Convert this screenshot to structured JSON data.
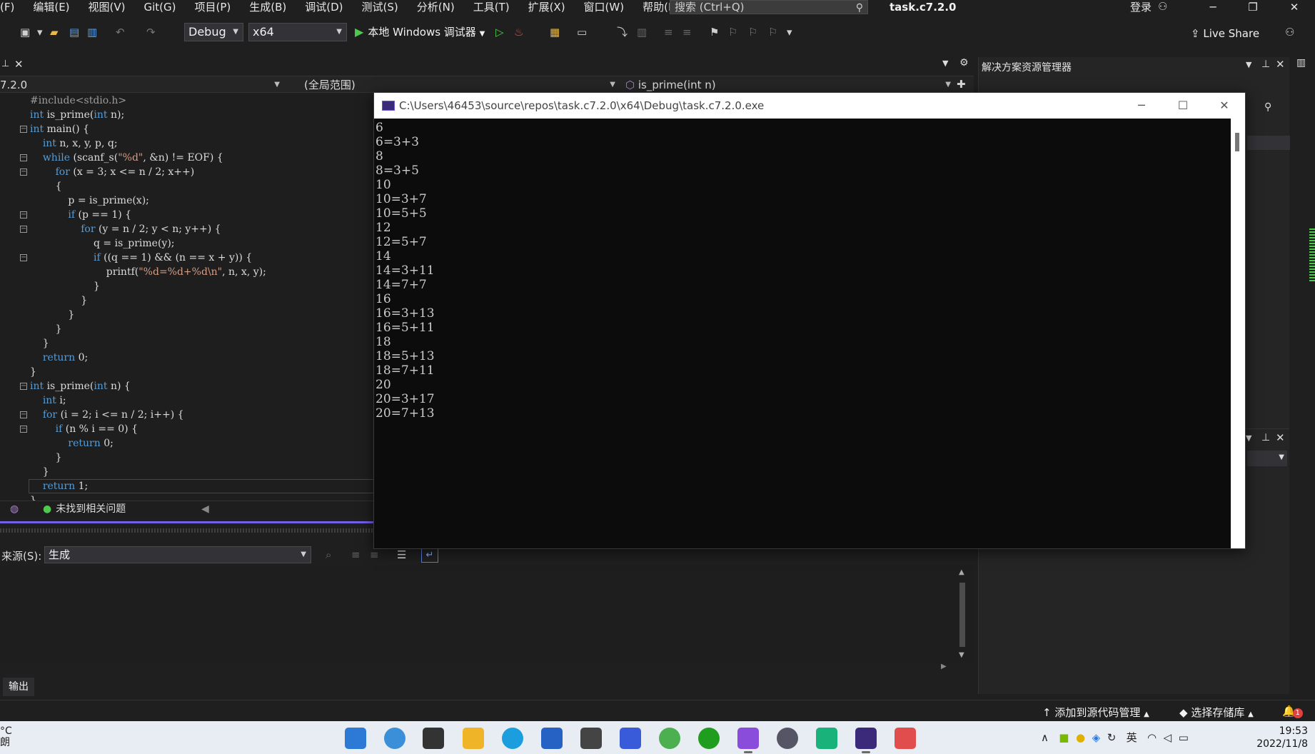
{
  "menu": {
    "items": [
      "(F)",
      "编辑(E)",
      "视图(V)",
      "Git(G)",
      "项目(P)",
      "生成(B)",
      "调试(D)",
      "测试(S)",
      "分析(N)",
      "工具(T)",
      "扩展(X)",
      "窗口(W)",
      "帮助(H)"
    ],
    "search_placeholder": "搜索 (Ctrl+Q)",
    "solution_title": "task.c7.2.0",
    "login": "登录",
    "window_buttons": [
      "─",
      "❐",
      "✕"
    ]
  },
  "toolbar": {
    "config": "Debug",
    "platform": "x64",
    "run_label": "本地 Windows 调试器",
    "live_share": "Live Share"
  },
  "nav": {
    "project": "7.2.0",
    "scope": "(全局范围)",
    "member": "is_prime(int n)"
  },
  "editor": {
    "status": "未找到相关问题"
  },
  "solution_explorer": {
    "title": "解决方案资源管理器"
  },
  "output": {
    "source_label": "来源(S):",
    "source_value": "生成",
    "tab": "输出"
  },
  "console": {
    "path": "C:\\Users\\46453\\source\\repos\\task.c7.2.0\\x64\\Debug\\task.c7.2.0.exe",
    "lines": [
      "6",
      "6=3+3",
      "8",
      "8=3+5",
      "10",
      "10=3+7",
      "10=5+5",
      "12",
      "12=5+7",
      "14",
      "14=3+11",
      "14=7+7",
      "16",
      "16=3+13",
      "16=5+11",
      "18",
      "18=5+13",
      "18=7+11",
      "20",
      "20=3+17",
      "20=7+13"
    ]
  },
  "statusbar": {
    "source_control": "添加到源代码管理",
    "repo": "选择存储库",
    "notifications": "1"
  },
  "taskbar": {
    "weather_temp": "°C",
    "weather_desc": "朗",
    "ime": "英",
    "time": "19:53",
    "date": "2022/11/8"
  }
}
